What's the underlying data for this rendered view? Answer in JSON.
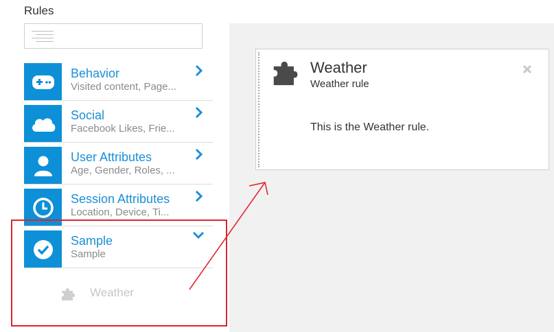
{
  "panel": {
    "title": "Rules",
    "search": {
      "value": "",
      "placeholder": ""
    }
  },
  "categories": [
    {
      "name": "Behavior",
      "description": "Visited content, Page...",
      "icon": "gamepad-icon",
      "state": "collapsed"
    },
    {
      "name": "Social",
      "description": "Facebook Likes, Frie...",
      "icon": "cloud-icon",
      "state": "collapsed"
    },
    {
      "name": "User Attributes",
      "description": "Age, Gender, Roles, ...",
      "icon": "user-icon",
      "state": "collapsed"
    },
    {
      "name": "Session Attributes",
      "description": "Location, Device, Ti...",
      "icon": "clock-icon",
      "state": "collapsed"
    },
    {
      "name": "Sample",
      "description": "Sample",
      "icon": "check-circle-icon",
      "state": "expanded"
    }
  ],
  "sample_rules": [
    {
      "label": "Weather",
      "icon": "puzzle-icon"
    }
  ],
  "rule_card": {
    "title": "Weather",
    "subtitle": "Weather rule",
    "body": "This is the Weather rule.",
    "icon": "puzzle-icon"
  },
  "colors": {
    "accent": "#0d90d8",
    "link": "#1a8fd6",
    "highlight_box": "#d8262e",
    "canvas_bg": "#f1f1f1"
  }
}
